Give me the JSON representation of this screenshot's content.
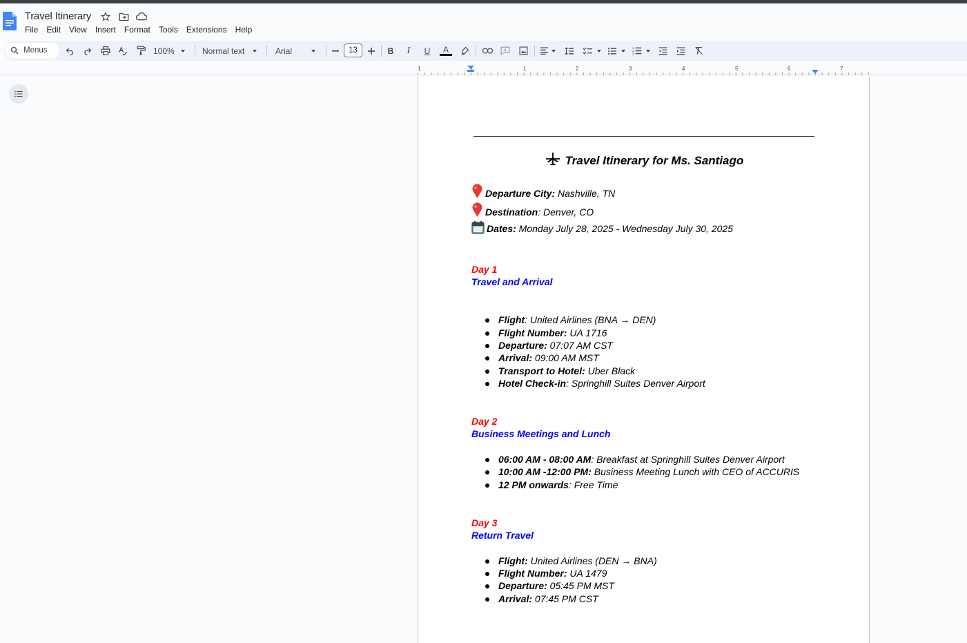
{
  "app": {
    "doc_title": "Travel Itinerary",
    "menu": [
      "File",
      "Edit",
      "View",
      "Insert",
      "Format",
      "Tools",
      "Extensions",
      "Help"
    ]
  },
  "toolbar": {
    "search_label": "Menus",
    "zoom": "100%",
    "style": "Normal text",
    "font": "Arial",
    "font_size": "13",
    "text_color": "#000000"
  },
  "ruler": {
    "labels": [
      "1",
      "1",
      "1",
      "2",
      "3",
      "4",
      "5",
      "6",
      "7"
    ]
  },
  "document": {
    "heading": "Travel Itinerary for Ms. Santiago",
    "trip": {
      "departure_label": "Departure City:",
      "departure_value": " Nashville, TN",
      "destination_label": "Destination",
      "destination_value": ": Denver, CO",
      "dates_label": "Dates:",
      "dates_value": " Monday July 28, 2025 - Wednesday July 30, 2025"
    },
    "days": [
      {
        "label": "Day 1",
        "title": "Travel and Arrival",
        "items": [
          {
            "key": "Flight",
            "value": ": United Airlines (BNA → DEN)"
          },
          {
            "key": "Flight Number:",
            "value": " UA 1716"
          },
          {
            "key": "Departure:",
            "value": " 07:07 AM CST"
          },
          {
            "key": "Arrival:",
            "value": " 09:00 AM MST"
          },
          {
            "key": "Transport to Hotel:",
            "value": " Uber Black"
          },
          {
            "key": "Hotel Check-in",
            "value": ": Springhill Suites Denver Airport"
          }
        ]
      },
      {
        "label": "Day 2",
        "title": "Business Meetings and Lunch",
        "items": [
          {
            "key": "06:00 AM - 08:00 AM",
            "value": ": Breakfast at Springhill Suites Denver Airport"
          },
          {
            "key": "10:00 AM -12:00 PM:",
            "value": " Business Meeting Lunch with CEO of ACCURIS"
          },
          {
            "key": "12 PM onwards",
            "value": ": Free Time"
          }
        ]
      },
      {
        "label": "Day 3",
        "title": "Return Travel",
        "items": [
          {
            "key": "Flight:",
            "value": " United Airlines (DEN → BNA)"
          },
          {
            "key": "Flight Number:",
            "value": " UA 1479"
          },
          {
            "key": "Departure:",
            "value": " 05:45 PM MST"
          },
          {
            "key": "Arrival:",
            "value": " 07:45 PM CST"
          }
        ]
      }
    ],
    "colors": {
      "day_label": "#ff0000",
      "day_title": "#0000ff",
      "pin": "#e53935"
    }
  },
  "icons": [
    "docs-logo-icon",
    "star-icon",
    "move-folder-icon",
    "cloud-status-icon",
    "search-icon",
    "undo-icon",
    "redo-icon",
    "print-icon",
    "spellcheck-icon",
    "paint-format-icon",
    "bold-icon",
    "italic-icon",
    "underline-icon",
    "text-color-icon",
    "highlight-icon",
    "link-icon",
    "comment-icon",
    "image-icon",
    "align-icon",
    "line-spacing-icon",
    "checklist-icon",
    "bulleted-list-icon",
    "numbered-list-icon",
    "decrease-indent-icon",
    "increase-indent-icon",
    "clear-formatting-icon",
    "outline-icon",
    "airplane-icon",
    "map-pin-icon",
    "calendar-icon"
  ]
}
